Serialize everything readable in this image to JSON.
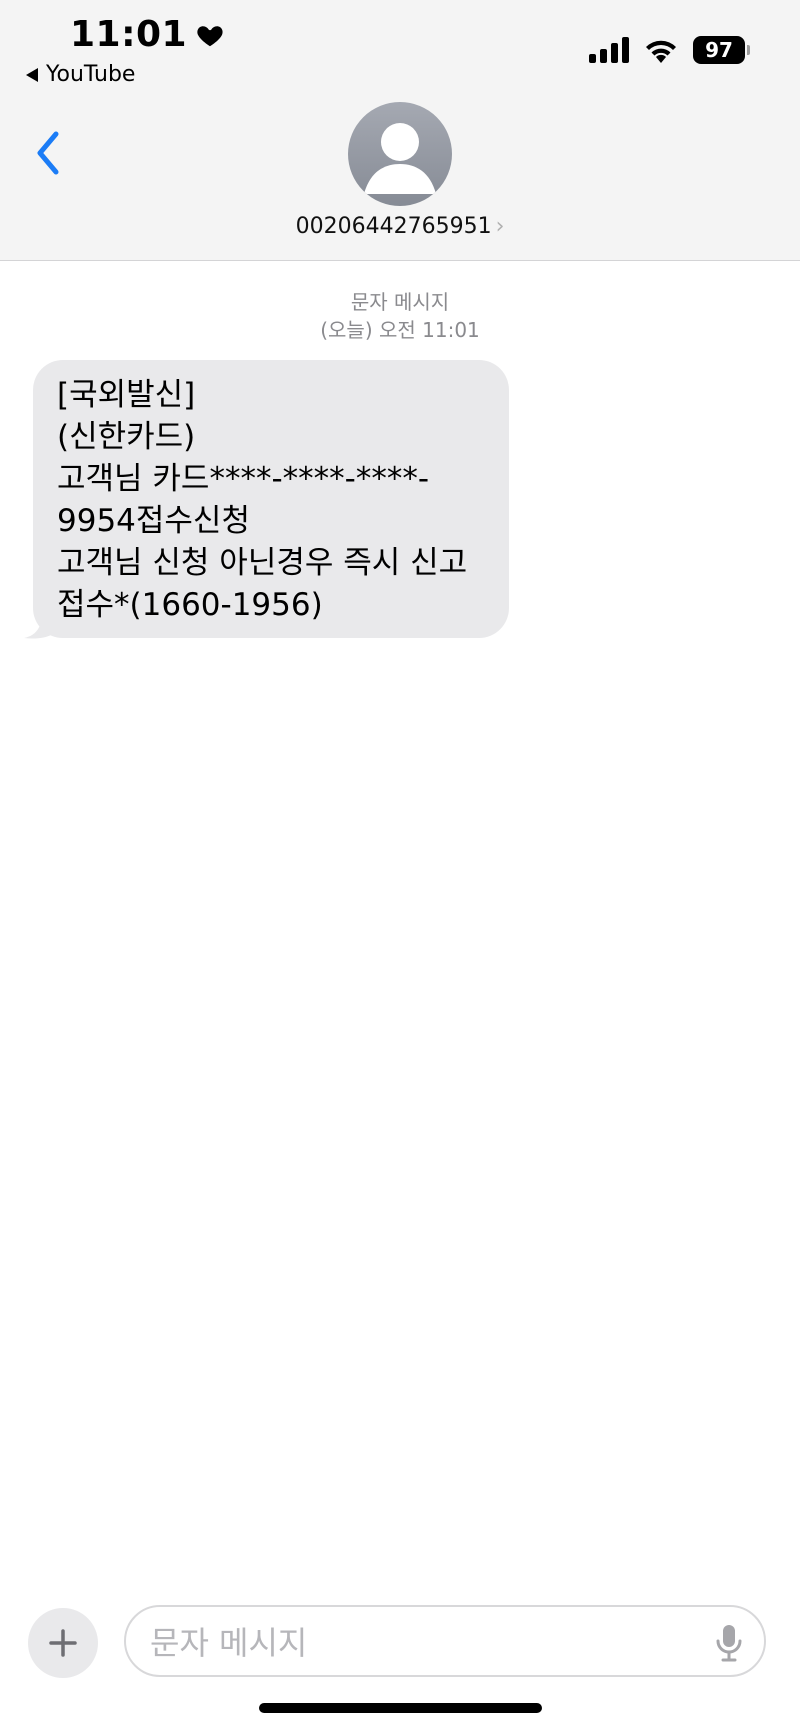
{
  "status_bar": {
    "time": "11:01",
    "heart_icon": "heart-icon",
    "back_app_label": "YouTube",
    "battery": "97"
  },
  "header": {
    "contact_number": "00206442765951",
    "chevron": "›"
  },
  "conversation": {
    "service_label": "문자 메시지",
    "timestamp": "(오늘) 오전 11:01",
    "message_lines": [
      "[국외발신]",
      "(신한카드)",
      "고객님 카드****-****-****-",
      "9954접수신청",
      "고객님 신청 아닌경우 즉시 신고",
      "접수*(1660-1956)"
    ]
  },
  "composer": {
    "placeholder": "문자 메시지"
  },
  "colors": {
    "accent": "#1b7cf6",
    "bubble": "#e9e9eb",
    "header_bg": "#f4f4f4"
  }
}
